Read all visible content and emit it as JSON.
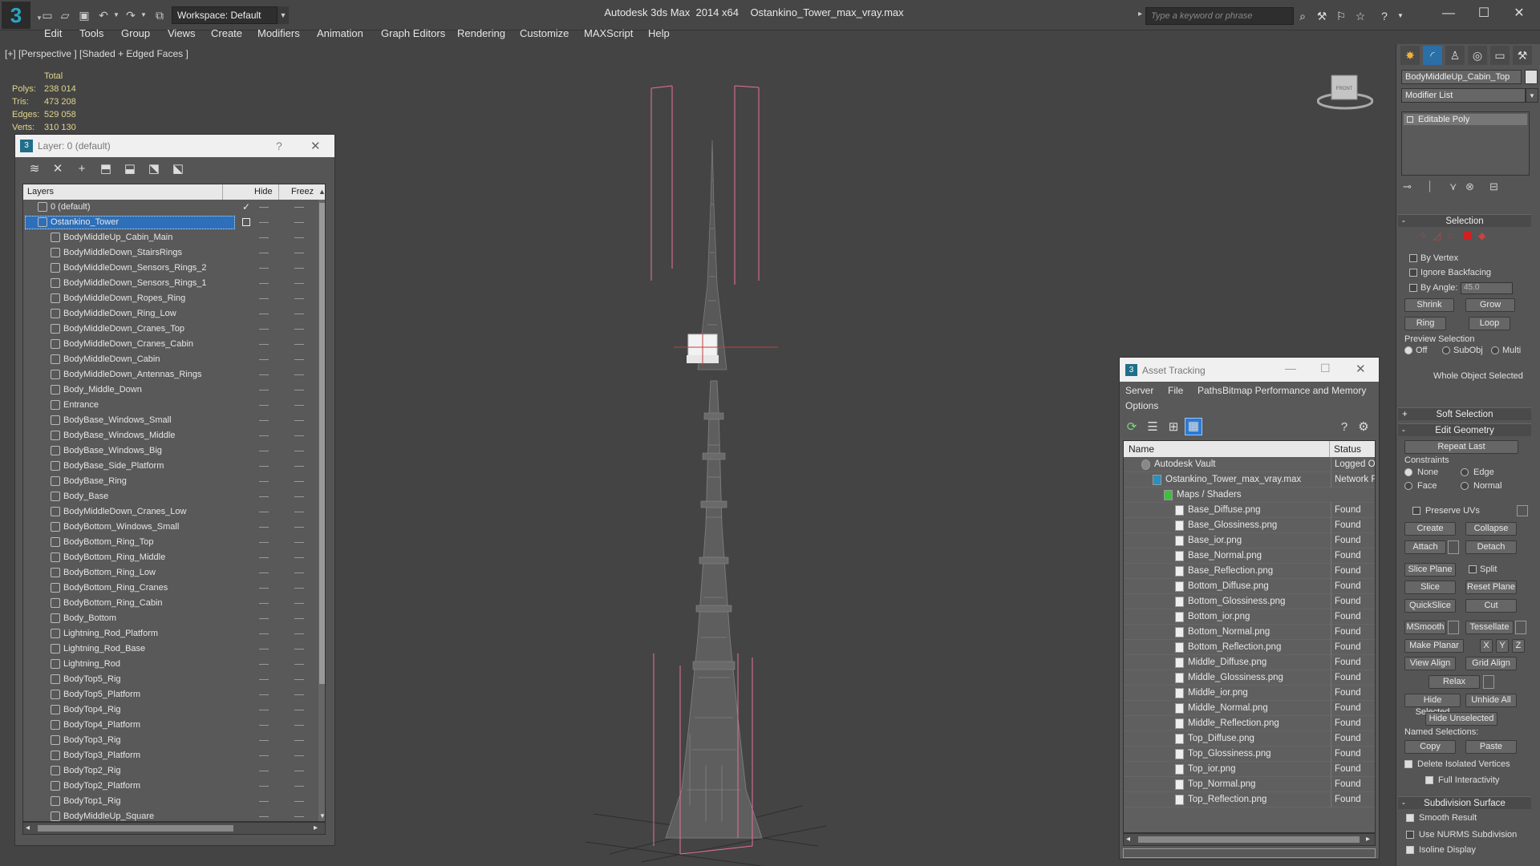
{
  "titlebar": {
    "workspace": "Workspace: Default",
    "app_name": "Autodesk 3ds Max  2014 x64",
    "file_name": "Ostankino_Tower_max_vray.max",
    "search_placeholder": "Type a keyword or phrase"
  },
  "menu": [
    "Edit",
    "Tools",
    "Group",
    "Views",
    "Create",
    "Modifiers",
    "Animation",
    "Graph Editors",
    "Rendering",
    "Customize",
    "MAXScript",
    "Help"
  ],
  "viewport": {
    "label": "[+] [Perspective ] [Shaded + Edged Faces ]",
    "stats_header": "Total",
    "stats": [
      {
        "label": "Polys:",
        "value": "238 014"
      },
      {
        "label": "Tris:",
        "value": "473 208"
      },
      {
        "label": "Edges:",
        "value": "529 058"
      },
      {
        "label": "Verts:",
        "value": "310 130"
      }
    ],
    "viewcube_label": "FRONT"
  },
  "layer_dialog": {
    "title": "Layer: 0 (default)",
    "help": "?",
    "close": "✕",
    "col_layers": "Layers",
    "col_hide": "Hide",
    "col_freeze": "Freez",
    "layers": [
      {
        "name": "0 (default)",
        "level": 0,
        "checked": true
      },
      {
        "name": "Ostankino_Tower",
        "level": 0,
        "selected": true
      },
      {
        "name": "BodyMiddleUp_Cabin_Main",
        "level": 1
      },
      {
        "name": "BodyMiddleDown_StairsRings",
        "level": 1
      },
      {
        "name": "BodyMiddleDown_Sensors_Rings_2",
        "level": 1
      },
      {
        "name": "BodyMiddleDown_Sensors_Rings_1",
        "level": 1
      },
      {
        "name": "BodyMiddleDown_Ropes_Ring",
        "level": 1
      },
      {
        "name": "BodyMiddleDown_Ring_Low",
        "level": 1
      },
      {
        "name": "BodyMiddleDown_Cranes_Top",
        "level": 1
      },
      {
        "name": "BodyMiddleDown_Cranes_Cabin",
        "level": 1
      },
      {
        "name": "BodyMiddleDown_Cabin",
        "level": 1
      },
      {
        "name": "BodyMiddleDown_Antennas_Rings",
        "level": 1
      },
      {
        "name": "Body_Middle_Down",
        "level": 1
      },
      {
        "name": "Entrance",
        "level": 1
      },
      {
        "name": "BodyBase_Windows_Small",
        "level": 1
      },
      {
        "name": "BodyBase_Windows_Middle",
        "level": 1
      },
      {
        "name": "BodyBase_Windows_Big",
        "level": 1
      },
      {
        "name": "BodyBase_Side_Platform",
        "level": 1
      },
      {
        "name": "BodyBase_Ring",
        "level": 1
      },
      {
        "name": "Body_Base",
        "level": 1
      },
      {
        "name": "BodyMiddleDown_Cranes_Low",
        "level": 1
      },
      {
        "name": "BodyBottom_Windows_Small",
        "level": 1
      },
      {
        "name": "BodyBottom_Ring_Top",
        "level": 1
      },
      {
        "name": "BodyBottom_Ring_Middle",
        "level": 1
      },
      {
        "name": "BodyBottom_Ring_Low",
        "level": 1
      },
      {
        "name": "BodyBottom_Ring_Cranes",
        "level": 1
      },
      {
        "name": "BodyBottom_Ring_Cabin",
        "level": 1
      },
      {
        "name": "Body_Bottom",
        "level": 1
      },
      {
        "name": "Lightning_Rod_Platform",
        "level": 1
      },
      {
        "name": "Lightning_Rod_Base",
        "level": 1
      },
      {
        "name": "Lightning_Rod",
        "level": 1
      },
      {
        "name": "BodyTop5_Rig",
        "level": 1
      },
      {
        "name": "BodyTop5_Platform",
        "level": 1
      },
      {
        "name": "BodyTop4_Rig",
        "level": 1
      },
      {
        "name": "BodyTop4_Platform",
        "level": 1
      },
      {
        "name": "BodyTop3_Rig",
        "level": 1
      },
      {
        "name": "BodyTop3_Platform",
        "level": 1
      },
      {
        "name": "BodyTop2_Rig",
        "level": 1
      },
      {
        "name": "BodyTop2_Platform",
        "level": 1
      },
      {
        "name": "BodyTop1_Rig",
        "level": 1
      },
      {
        "name": "BodyMiddleUp_Square",
        "level": 1
      }
    ]
  },
  "asset_dialog": {
    "title": "Asset Tracking",
    "menu": [
      "Server",
      "File",
      "Paths",
      "Bitmap Performance and Memory"
    ],
    "menu_options": "Options",
    "col_name": "Name",
    "col_status": "Status",
    "rows": [
      {
        "name": "Autodesk Vault",
        "status": "Logged O",
        "level": 0,
        "kind": "vault"
      },
      {
        "name": "Ostankino_Tower_max_vray.max",
        "status": "Network F",
        "level": 1,
        "kind": "max"
      },
      {
        "name": "Maps / Shaders",
        "status": "",
        "level": 2,
        "kind": "maps"
      },
      {
        "name": "Base_Diffuse.png",
        "status": "Found",
        "level": 3,
        "kind": "file"
      },
      {
        "name": "Base_Glossiness.png",
        "status": "Found",
        "level": 3,
        "kind": "file"
      },
      {
        "name": "Base_ior.png",
        "status": "Found",
        "level": 3,
        "kind": "file"
      },
      {
        "name": "Base_Normal.png",
        "status": "Found",
        "level": 3,
        "kind": "file"
      },
      {
        "name": "Base_Reflection.png",
        "status": "Found",
        "level": 3,
        "kind": "file"
      },
      {
        "name": "Bottom_Diffuse.png",
        "status": "Found",
        "level": 3,
        "kind": "file"
      },
      {
        "name": "Bottom_Glossiness.png",
        "status": "Found",
        "level": 3,
        "kind": "file"
      },
      {
        "name": "Bottom_ior.png",
        "status": "Found",
        "level": 3,
        "kind": "file"
      },
      {
        "name": "Bottom_Normal.png",
        "status": "Found",
        "level": 3,
        "kind": "file"
      },
      {
        "name": "Bottom_Reflection.png",
        "status": "Found",
        "level": 3,
        "kind": "file"
      },
      {
        "name": "Middle_Diffuse.png",
        "status": "Found",
        "level": 3,
        "kind": "file"
      },
      {
        "name": "Middle_Glossiness.png",
        "status": "Found",
        "level": 3,
        "kind": "file"
      },
      {
        "name": "Middle_ior.png",
        "status": "Found",
        "level": 3,
        "kind": "file"
      },
      {
        "name": "Middle_Normal.png",
        "status": "Found",
        "level": 3,
        "kind": "file"
      },
      {
        "name": "Middle_Reflection.png",
        "status": "Found",
        "level": 3,
        "kind": "file"
      },
      {
        "name": "Top_Diffuse.png",
        "status": "Found",
        "level": 3,
        "kind": "file"
      },
      {
        "name": "Top_Glossiness.png",
        "status": "Found",
        "level": 3,
        "kind": "file"
      },
      {
        "name": "Top_ior.png",
        "status": "Found",
        "level": 3,
        "kind": "file"
      },
      {
        "name": "Top_Normal.png",
        "status": "Found",
        "level": 3,
        "kind": "file"
      },
      {
        "name": "Top_Reflection.png",
        "status": "Found",
        "level": 3,
        "kind": "file"
      }
    ]
  },
  "command_panel": {
    "object_name": "BodyMiddleUp_Cabin_Top",
    "modifier_list": "Modifier List",
    "modifier_stack": [
      "Editable Poly"
    ],
    "selection": {
      "title": "Selection",
      "by_vertex": "By Vertex",
      "ignore_backfacing": "Ignore Backfacing",
      "by_angle": "By Angle:",
      "angle_value": "45.0",
      "shrink": "Shrink",
      "grow": "Grow",
      "ring": "Ring",
      "loop": "Loop",
      "preview_selection": "Preview Selection",
      "preview_off": "Off",
      "preview_subobj": "SubObj",
      "preview_multi": "Multi",
      "status": "Whole Object Selected"
    },
    "soft_selection": "Soft Selection",
    "edit_geometry": {
      "title": "Edit Geometry",
      "repeat_last": "Repeat Last",
      "constraints": "Constraints",
      "none": "None",
      "edge": "Edge",
      "face": "Face",
      "normal": "Normal",
      "preserve_uvs": "Preserve UVs",
      "create": "Create",
      "collapse": "Collapse",
      "attach": "Attach",
      "detach": "Detach",
      "slice_plane": "Slice Plane",
      "split": "Split",
      "slice": "Slice",
      "reset_plane": "Reset Plane",
      "quickslice": "QuickSlice",
      "cut": "Cut",
      "msmooth": "MSmooth",
      "tessellate": "Tessellate",
      "make_planar": "Make Planar",
      "x": "X",
      "y": "Y",
      "z": "Z",
      "view_align": "View Align",
      "grid_align": "Grid Align",
      "relax": "Relax",
      "hide_selected": "Hide Selected",
      "unhide_all": "Unhide All",
      "hide_unselected": "Hide Unselected",
      "named_selections": "Named Selections:",
      "copy": "Copy",
      "paste": "Paste",
      "delete_isolated": "Delete Isolated Vertices",
      "full_interactivity": "Full Interactivity"
    },
    "subdivision": {
      "title": "Subdivision Surface",
      "smooth_result": "Smooth Result",
      "use_nurms": "Use NURMS Subdivision",
      "isoline_display": "Isoline Display"
    }
  }
}
